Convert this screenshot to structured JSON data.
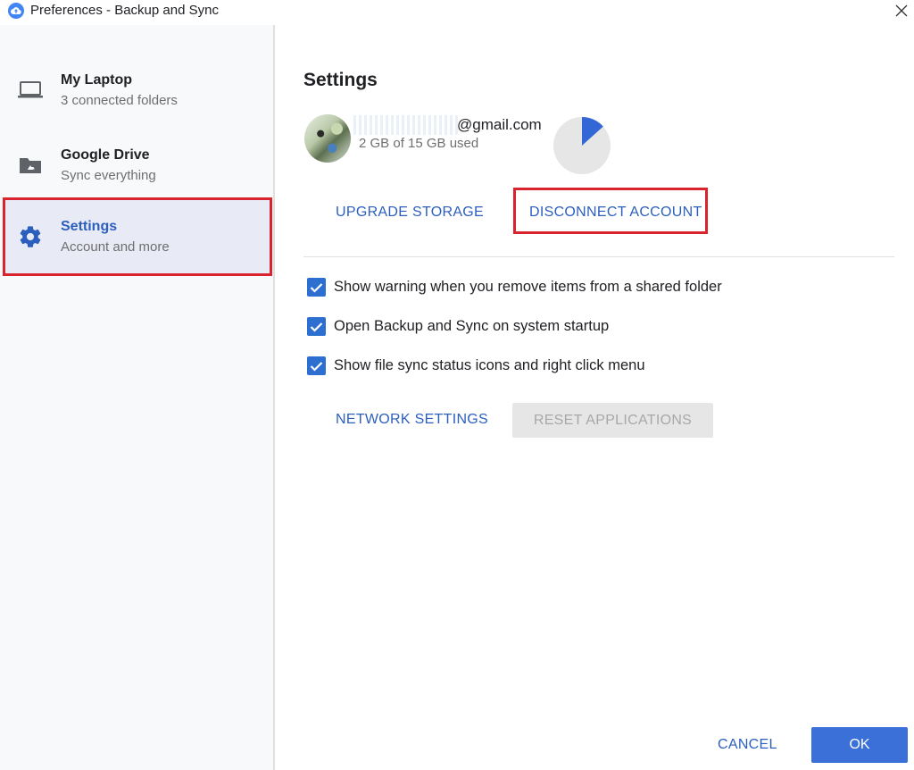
{
  "window": {
    "title": "Preferences - Backup and Sync",
    "app_icon": "backup-sync-cloud-icon",
    "close_icon": "close-icon"
  },
  "sidebar": {
    "items": [
      {
        "icon": "laptop-icon",
        "title": "My Laptop",
        "subtitle": "3 connected folders",
        "active": false
      },
      {
        "icon": "drive-folder-icon",
        "title": "Google Drive",
        "subtitle": "Sync everything",
        "active": false
      },
      {
        "icon": "gear-icon",
        "title": "Settings",
        "subtitle": "Account and more",
        "active": true
      }
    ]
  },
  "main": {
    "title": "Settings",
    "account": {
      "email_domain": "@gmail.com",
      "storage_used": "2 GB of 15 GB used",
      "storage_fraction": 0.1333
    },
    "upgrade_label": "UPGRADE STORAGE",
    "disconnect_label": "DISCONNECT ACCOUNT",
    "options": [
      {
        "label": "Show warning when you remove items from a shared folder",
        "checked": true
      },
      {
        "label": "Open Backup and Sync on system startup",
        "checked": true
      },
      {
        "label": "Show file sync status icons and right click menu",
        "checked": true
      }
    ],
    "network_label": "NETWORK SETTINGS",
    "reset_label": "RESET APPLICATIONS",
    "reset_disabled": true
  },
  "footer": {
    "cancel_label": "CANCEL",
    "ok_label": "OK"
  },
  "colors": {
    "accent": "#2c5fbd",
    "primary_button": "#3a70d8",
    "highlight_box": "#d9232e",
    "pie_fill": "#3367d6",
    "pie_track": "#e6e6e6"
  }
}
